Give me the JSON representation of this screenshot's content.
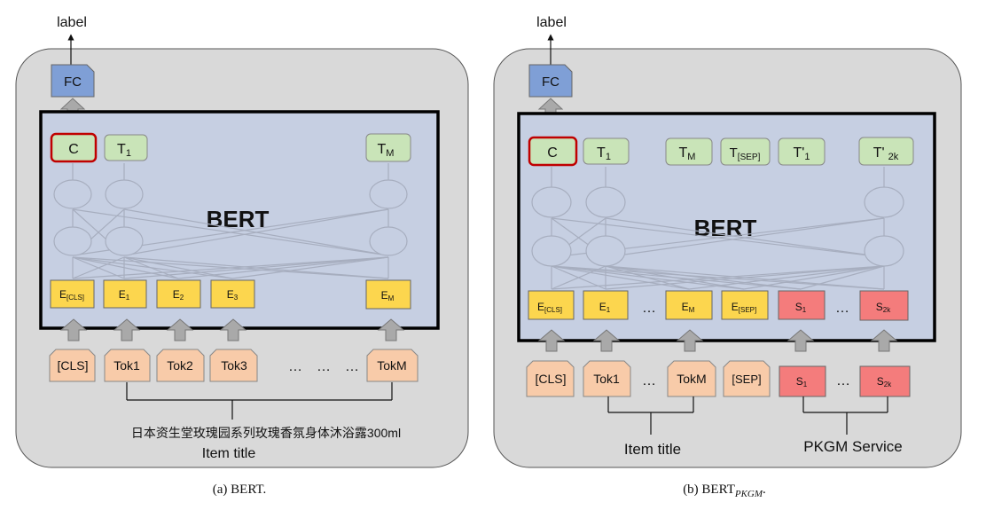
{
  "panel_a": {
    "output_label": "label",
    "fc": "FC",
    "bert": "BERT",
    "out_c": "C",
    "out_t1": "T",
    "out_t1_sub": "1",
    "out_tm": "T",
    "out_tm_sub": "M",
    "emb": [
      {
        "base": "E",
        "sub": "[CLS]"
      },
      {
        "base": "E",
        "sub": "1"
      },
      {
        "base": "E",
        "sub": "2"
      },
      {
        "base": "E",
        "sub": "3"
      },
      {
        "base": "E",
        "sub": "M"
      }
    ],
    "tokens": [
      "[CLS]",
      "Tok1",
      "Tok2",
      "Tok3",
      "TokM"
    ],
    "dots": [
      "…",
      "…",
      "…"
    ],
    "chinese_title": "日本资生堂玫瑰园系列玫瑰香氛身体沐浴露300ml",
    "item_title": "Item title",
    "caption": "(a)  BERT."
  },
  "panel_b": {
    "output_label": "label",
    "fc": "FC",
    "bert": "BERT",
    "out_c": "C",
    "outputs": [
      {
        "base": "T",
        "sub": "1"
      },
      {
        "base": "T",
        "sub": "M"
      },
      {
        "base": "T",
        "sub": "[SEP]"
      },
      {
        "base": "T'",
        "sub": "1"
      },
      {
        "base": "T'",
        "sub": "2k"
      }
    ],
    "emb": [
      {
        "base": "E",
        "sub": "[CLS]"
      },
      {
        "base": "E",
        "sub": "1"
      },
      {
        "base": "E",
        "sub": "M"
      },
      {
        "base": "E",
        "sub": "[SEP]"
      },
      {
        "base": "S",
        "sub": "1"
      },
      {
        "base": "S",
        "sub": "2k"
      }
    ],
    "emb_dots": [
      "…",
      "…"
    ],
    "tokens": [
      "[CLS]",
      "Tok1",
      "TokM",
      "[SEP]"
    ],
    "service_tokens": [
      {
        "base": "S",
        "sub": "1"
      },
      {
        "base": "S",
        "sub": "2k"
      }
    ],
    "tok_dots": [
      "…",
      "…"
    ],
    "item_title": "Item title",
    "service_label": "PKGM Service",
    "caption_main": "(b)  BERT",
    "caption_sub": "PKGM",
    "caption_end": "."
  },
  "colors": {
    "panel_bg": "#d9d9d9",
    "bert_bg": "#c6cfe2",
    "fc": "#7f9fd6",
    "output_green": "#c9e4b8",
    "emb_yellow": "#fcd64e",
    "token_peach": "#f8cba9",
    "service_red": "#f47c7c",
    "c_border": "#c00000",
    "arrow_gray": "#a9a9a9"
  }
}
